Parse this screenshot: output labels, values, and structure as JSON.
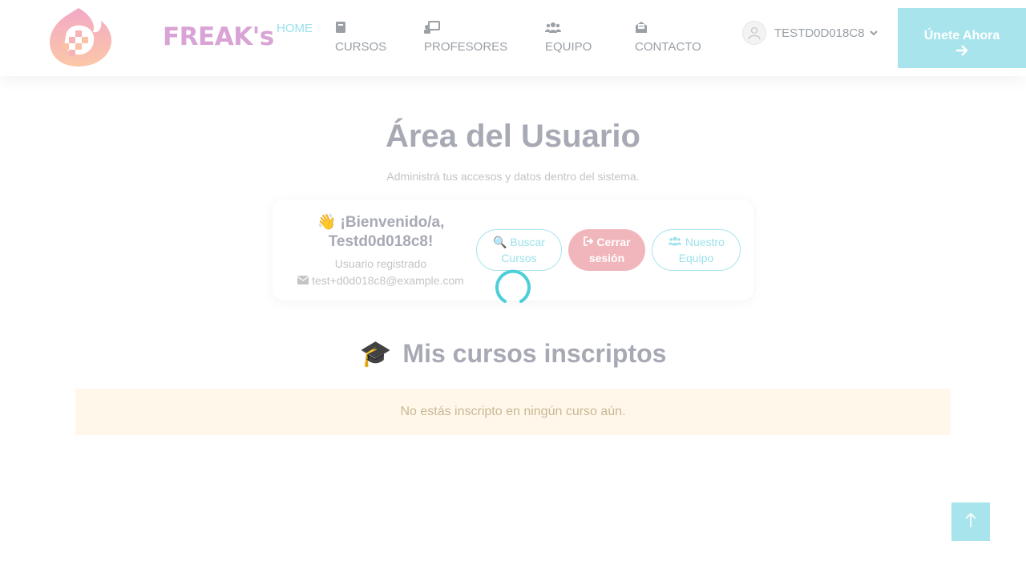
{
  "brand": {
    "name": "FREAK's",
    "logo_icon": "flame-pixel-logo"
  },
  "nav": {
    "home": "HOME",
    "items": [
      {
        "label": "CURSOS",
        "icon": "book-icon"
      },
      {
        "label": "PROFESORES",
        "icon": "teacher-icon"
      },
      {
        "label": "EQUIPO",
        "icon": "users-icon"
      },
      {
        "label": "CONTACTO",
        "icon": "envelope-open-icon"
      }
    ]
  },
  "user": {
    "name": "TESTD0D018C8",
    "avatar_icon": "user-avatar-icon"
  },
  "cta": {
    "label": "Únete Ahora",
    "icon": "arrow-right-icon"
  },
  "page": {
    "title": "Área del Usuario",
    "subtitle": "Administrá tus accesos y datos dentro del sistema."
  },
  "welcome_card": {
    "greeting": "¡Bienvenido/a,",
    "username": "Testd0d018c8!",
    "wave_icon": "👋",
    "role": "Usuario registrado",
    "email": "test+d0d018c8@example.com",
    "buttons": {
      "buscar": {
        "line1": "Buscar",
        "line2": "Cursos",
        "icon": "🔍"
      },
      "cerrar": {
        "line1": "Cerrar",
        "line2": "sesión",
        "icon": "sign-out-icon"
      },
      "equipo": {
        "line1": "Nuestro",
        "line2": "Equipo",
        "icon": "users-icon"
      }
    }
  },
  "courses": {
    "title": "Mis cursos inscriptos",
    "icon": "🎓",
    "empty_message": "No estás inscripto en ningún curso aún."
  },
  "colors": {
    "accent": "#a8e4ec",
    "brand_pink": "#d9a3d6",
    "danger": "#f1b6bb",
    "alert_bg": "#fff8ea",
    "heading": "#a7a9b4"
  }
}
